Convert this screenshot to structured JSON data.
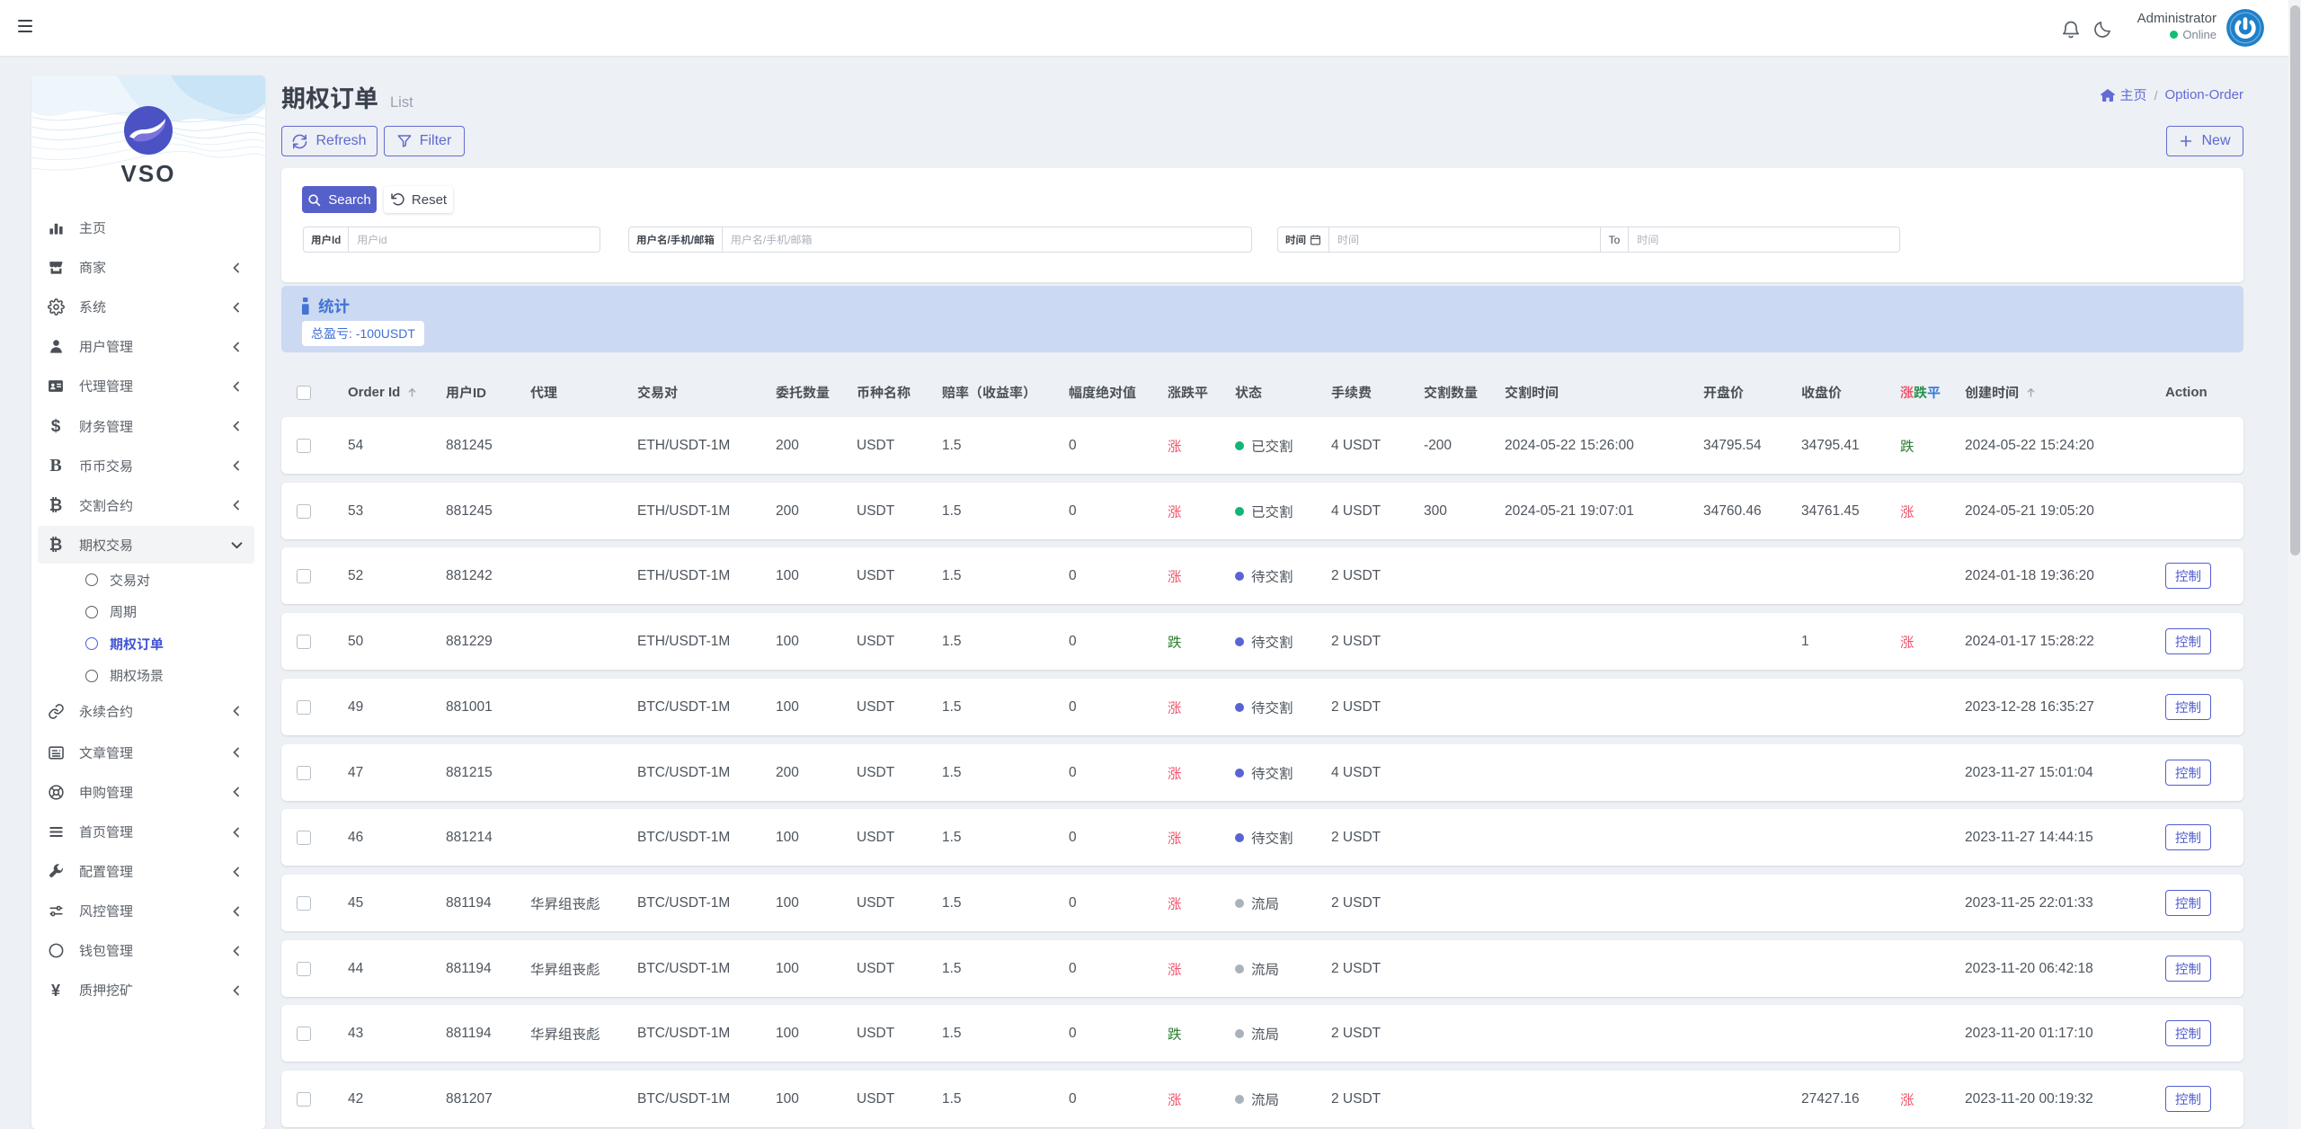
{
  "topbar": {
    "admin_name": "Administrator",
    "admin_status": "Online"
  },
  "brand": {
    "name": "VSO"
  },
  "sidebar": {
    "items": [
      {
        "label": "主页",
        "icon": "chart-bars-icon"
      },
      {
        "label": "商家",
        "icon": "store-icon",
        "chevron": true
      },
      {
        "label": "系统",
        "icon": "gear-icon",
        "chevron": true
      },
      {
        "label": "用户管理",
        "icon": "user-icon",
        "chevron": true
      },
      {
        "label": "代理管理",
        "icon": "id-card-icon",
        "chevron": true
      },
      {
        "label": "财务管理",
        "icon": "dollar-icon",
        "chevron": true
      },
      {
        "label": "币币交易",
        "icon": "letter-b-icon",
        "chevron": true
      },
      {
        "label": "交割合约",
        "icon": "bitcoin-icon",
        "chevron": true
      },
      {
        "label": "期权交易",
        "icon": "bitcoin-icon",
        "expanded": true,
        "children": [
          {
            "label": "交易对"
          },
          {
            "label": "周期"
          },
          {
            "label": "期权订单",
            "active": true
          },
          {
            "label": "期权场景"
          }
        ]
      },
      {
        "label": "永续合约",
        "icon": "link-icon",
        "chevron": true
      },
      {
        "label": "文章管理",
        "icon": "newspaper-icon",
        "chevron": true
      },
      {
        "label": "申购管理",
        "icon": "life-ring-icon",
        "chevron": true
      },
      {
        "label": "首页管理",
        "icon": "list-icon",
        "chevron": true
      },
      {
        "label": "配置管理",
        "icon": "wrench-icon",
        "chevron": true
      },
      {
        "label": "风控管理",
        "icon": "sliders-icon",
        "chevron": true
      },
      {
        "label": "钱包管理",
        "icon": "circle-icon",
        "chevron": true
      },
      {
        "label": "质押挖矿",
        "icon": "yen-icon",
        "chevron": true
      }
    ]
  },
  "page": {
    "title": "期权订单",
    "subtitle": "List",
    "breadcrumb": {
      "home": "主页",
      "separator": "/",
      "current": "Option-Order"
    }
  },
  "toolbar": {
    "refresh_label": "Refresh",
    "filter_label": "Filter",
    "new_label": "New"
  },
  "filter_panel": {
    "search_label": "Search",
    "reset_label": "Reset",
    "user_id": {
      "label": "用户Id",
      "placeholder": "用户id",
      "value": ""
    },
    "user": {
      "label": "用户名/手机/邮箱",
      "placeholder": "用户名/手机/邮箱",
      "value": ""
    },
    "time": {
      "label": "时间",
      "placeholder_from": "时间",
      "to_label": "To",
      "placeholder_to": "时间",
      "value_from": "",
      "value_to": ""
    }
  },
  "stats": {
    "title": "统计",
    "total_pnl": "总盈亏: -100USDT"
  },
  "table": {
    "headers": [
      {
        "label": "Order Id",
        "sort": "asc"
      },
      {
        "label": "用户ID"
      },
      {
        "label": "代理"
      },
      {
        "label": "交易对"
      },
      {
        "label": "委托数量"
      },
      {
        "label": "币种名称"
      },
      {
        "label": "赔率（收益率）"
      },
      {
        "label": "幅度绝对值"
      },
      {
        "label": "涨跌平"
      },
      {
        "label": "状态"
      },
      {
        "label": "手续费"
      },
      {
        "label": "交割数量"
      },
      {
        "label": "交割时间"
      },
      {
        "label": "开盘价"
      },
      {
        "label": "收盘价"
      },
      {
        "label": "涨跌平",
        "colored": true
      },
      {
        "label": "创建时间",
        "sort": "asc"
      },
      {
        "label": "Action"
      }
    ],
    "action_label": "控制",
    "rows": [
      {
        "order_id": "54",
        "user_id": "881245",
        "agent": "",
        "pair": "ETH/USDT-1M",
        "amount": "200",
        "coin": "USDT",
        "odds": "1.5",
        "amplitude": "0",
        "side": "涨",
        "side_dir": "up",
        "status": "已交割",
        "status_type": "settled",
        "fee": "4 USDT",
        "delivery_qty": "-200",
        "delivery_time": "2024-05-22 15:26:00",
        "open_price": "34795.54",
        "close_price": "34795.41",
        "result": "跌",
        "result_dir": "down",
        "created_at": "2024-05-22 15:24:20",
        "has_action": false
      },
      {
        "order_id": "53",
        "user_id": "881245",
        "agent": "",
        "pair": "ETH/USDT-1M",
        "amount": "200",
        "coin": "USDT",
        "odds": "1.5",
        "amplitude": "0",
        "side": "涨",
        "side_dir": "up",
        "status": "已交割",
        "status_type": "settled",
        "fee": "4 USDT",
        "delivery_qty": "300",
        "delivery_time": "2024-05-21 19:07:01",
        "open_price": "34760.46",
        "close_price": "34761.45",
        "result": "涨",
        "result_dir": "up",
        "created_at": "2024-05-21 19:05:20",
        "has_action": false
      },
      {
        "order_id": "52",
        "user_id": "881242",
        "agent": "",
        "pair": "ETH/USDT-1M",
        "amount": "100",
        "coin": "USDT",
        "odds": "1.5",
        "amplitude": "0",
        "side": "涨",
        "side_dir": "up",
        "status": "待交割",
        "status_type": "pending",
        "fee": "2 USDT",
        "delivery_qty": "",
        "delivery_time": "",
        "open_price": "",
        "close_price": "",
        "result": "",
        "result_dir": "",
        "created_at": "2024-01-18 19:36:20",
        "has_action": true
      },
      {
        "order_id": "50",
        "user_id": "881229",
        "agent": "",
        "pair": "ETH/USDT-1M",
        "amount": "100",
        "coin": "USDT",
        "odds": "1.5",
        "amplitude": "0",
        "side": "跌",
        "side_dir": "down",
        "status": "待交割",
        "status_type": "pending",
        "fee": "2 USDT",
        "delivery_qty": "",
        "delivery_time": "",
        "open_price": "",
        "close_price": "1",
        "result": "涨",
        "result_dir": "up",
        "created_at": "2024-01-17 15:28:22",
        "has_action": true
      },
      {
        "order_id": "49",
        "user_id": "881001",
        "agent": "",
        "pair": "BTC/USDT-1M",
        "amount": "100",
        "coin": "USDT",
        "odds": "1.5",
        "amplitude": "0",
        "side": "涨",
        "side_dir": "up",
        "status": "待交割",
        "status_type": "pending",
        "fee": "2 USDT",
        "delivery_qty": "",
        "delivery_time": "",
        "open_price": "",
        "close_price": "",
        "result": "",
        "result_dir": "",
        "created_at": "2023-12-28 16:35:27",
        "has_action": true
      },
      {
        "order_id": "47",
        "user_id": "881215",
        "agent": "",
        "pair": "BTC/USDT-1M",
        "amount": "200",
        "coin": "USDT",
        "odds": "1.5",
        "amplitude": "0",
        "side": "涨",
        "side_dir": "up",
        "status": "待交割",
        "status_type": "pending",
        "fee": "4 USDT",
        "delivery_qty": "",
        "delivery_time": "",
        "open_price": "",
        "close_price": "",
        "result": "",
        "result_dir": "",
        "created_at": "2023-11-27 15:01:04",
        "has_action": true
      },
      {
        "order_id": "46",
        "user_id": "881214",
        "agent": "",
        "pair": "BTC/USDT-1M",
        "amount": "100",
        "coin": "USDT",
        "odds": "1.5",
        "amplitude": "0",
        "side": "涨",
        "side_dir": "up",
        "status": "待交割",
        "status_type": "pending",
        "fee": "2 USDT",
        "delivery_qty": "",
        "delivery_time": "",
        "open_price": "",
        "close_price": "",
        "result": "",
        "result_dir": "",
        "created_at": "2023-11-27 14:44:15",
        "has_action": true
      },
      {
        "order_id": "45",
        "user_id": "881194",
        "agent": "华昇组丧彪",
        "pair": "BTC/USDT-1M",
        "amount": "100",
        "coin": "USDT",
        "odds": "1.5",
        "amplitude": "0",
        "side": "涨",
        "side_dir": "up",
        "status": "流局",
        "status_type": "void",
        "fee": "2 USDT",
        "delivery_qty": "",
        "delivery_time": "",
        "open_price": "",
        "close_price": "",
        "result": "",
        "result_dir": "",
        "created_at": "2023-11-25 22:01:33",
        "has_action": true
      },
      {
        "order_id": "44",
        "user_id": "881194",
        "agent": "华昇组丧彪",
        "pair": "BTC/USDT-1M",
        "amount": "100",
        "coin": "USDT",
        "odds": "1.5",
        "amplitude": "0",
        "side": "涨",
        "side_dir": "up",
        "status": "流局",
        "status_type": "void",
        "fee": "2 USDT",
        "delivery_qty": "",
        "delivery_time": "",
        "open_price": "",
        "close_price": "",
        "result": "",
        "result_dir": "",
        "created_at": "2023-11-20 06:42:18",
        "has_action": true
      },
      {
        "order_id": "43",
        "user_id": "881194",
        "agent": "华昇组丧彪",
        "pair": "BTC/USDT-1M",
        "amount": "100",
        "coin": "USDT",
        "odds": "1.5",
        "amplitude": "0",
        "side": "跌",
        "side_dir": "down",
        "status": "流局",
        "status_type": "void",
        "fee": "2 USDT",
        "delivery_qty": "",
        "delivery_time": "",
        "open_price": "",
        "close_price": "",
        "result": "",
        "result_dir": "",
        "created_at": "2023-11-20 01:17:10",
        "has_action": true
      },
      {
        "order_id": "42",
        "user_id": "881207",
        "agent": "",
        "pair": "BTC/USDT-1M",
        "amount": "100",
        "coin": "USDT",
        "odds": "1.5",
        "amplitude": "0",
        "side": "涨",
        "side_dir": "up",
        "status": "流局",
        "status_type": "void",
        "fee": "2 USDT",
        "delivery_qty": "",
        "delivery_time": "",
        "open_price": "",
        "close_price": "27427.16",
        "result": "涨",
        "result_dir": "up",
        "created_at": "2023-11-20 00:19:32",
        "has_action": true
      }
    ]
  },
  "colors": {
    "primary": "#5b65cb",
    "primary_fill": "#5560c8",
    "up_red": "#f1556c",
    "down_green": "#2e7d32",
    "dot_settled": "#13b475",
    "dot_pending": "#5964d2",
    "dot_void": "#aab2bb",
    "stats_bg": "#cbd9f2",
    "stats_text": "#4374d4",
    "page_bg": "#edf0f5",
    "header_flat_blue": "#3a7bd5"
  }
}
